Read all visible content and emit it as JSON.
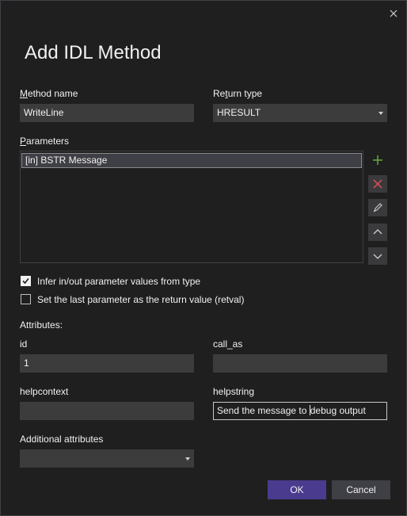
{
  "dialog": {
    "title": "Add IDL Method",
    "close_icon": "close-icon"
  },
  "method_name": {
    "label": "Method name",
    "value": "WriteLine"
  },
  "return_type": {
    "label": "Return type",
    "value": "HRESULT"
  },
  "parameters": {
    "label": "Parameters",
    "items": [
      "[in] BSTR Message"
    ],
    "buttons": {
      "add_icon": "plus-icon",
      "remove_icon": "x-icon",
      "edit_icon": "pencil-icon",
      "up_icon": "chevron-up-icon",
      "down_icon": "chevron-down-icon"
    }
  },
  "options": {
    "infer_label": "Infer in/out parameter values from type",
    "infer_checked": true,
    "retval_label": "Set the last parameter as the return value (retval)",
    "retval_checked": false
  },
  "attributes": {
    "heading": "Attributes:",
    "id": {
      "label": "id",
      "value": "1"
    },
    "call_as": {
      "label": "call_as",
      "value": ""
    },
    "helpcontext": {
      "label": "helpcontext",
      "value": ""
    },
    "helpstring": {
      "label": "helpstring",
      "value_before": "Send the message to ",
      "value_after": "debug output"
    },
    "additional": {
      "label": "Additional attributes",
      "value": ""
    }
  },
  "footer": {
    "ok": "OK",
    "cancel": "Cancel"
  },
  "colors": {
    "background": "#1f1f1f",
    "field": "#3c3c3c",
    "primary_button": "#4b3b8f",
    "add_icon": "#6db33f",
    "remove_icon": "#e05252"
  }
}
